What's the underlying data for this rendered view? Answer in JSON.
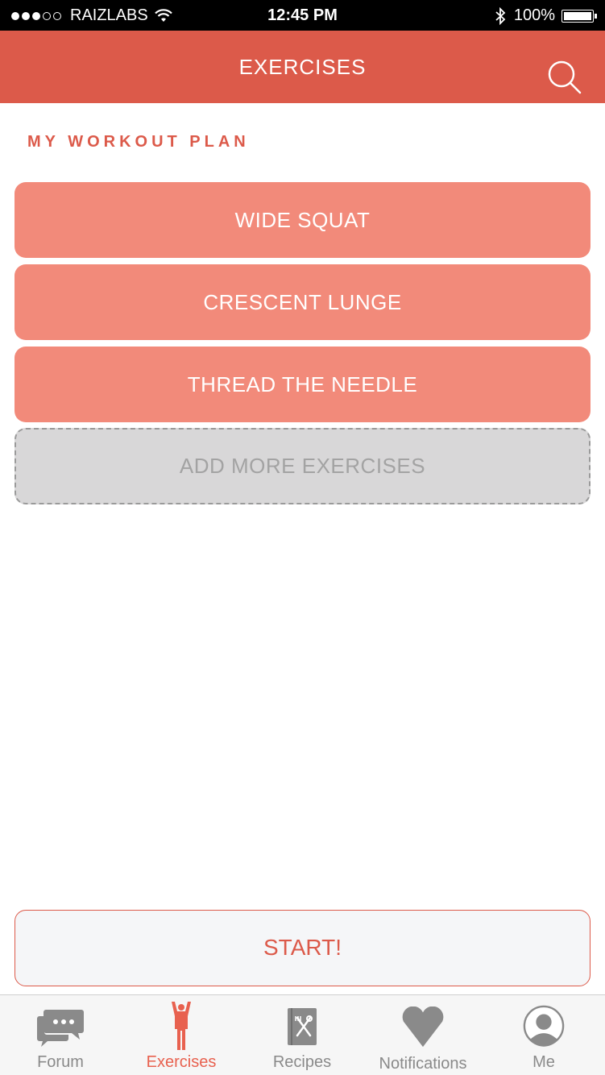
{
  "status_bar": {
    "carrier": "RAIZLABS",
    "time": "12:45 PM",
    "battery": "100%"
  },
  "nav": {
    "title": "EXERCISES",
    "search_icon": "search-icon"
  },
  "section_title": "MY WORKOUT PLAN",
  "exercises": [
    {
      "label": "WIDE SQUAT"
    },
    {
      "label": "CRESCENT LUNGE"
    },
    {
      "label": "THREAD THE NEEDLE"
    }
  ],
  "add_more_label": "ADD MORE EXERCISES",
  "start_label": "START!",
  "tabs": [
    {
      "label": "Forum",
      "icon": "chat-bubbles-icon"
    },
    {
      "label": "Exercises",
      "icon": "person-arms-up-icon",
      "active": true
    },
    {
      "label": "Recipes",
      "icon": "recipe-book-icon"
    },
    {
      "label": "Notifications",
      "icon": "heart-icon"
    },
    {
      "label": "Me",
      "icon": "profile-icon"
    }
  ],
  "colors": {
    "accent": "#dc5a4a",
    "exercise_bg": "#f28a7a",
    "add_more_bg": "#d8d7d8",
    "tab_inactive": "#8a8a8a",
    "tab_active": "#e8614f"
  }
}
